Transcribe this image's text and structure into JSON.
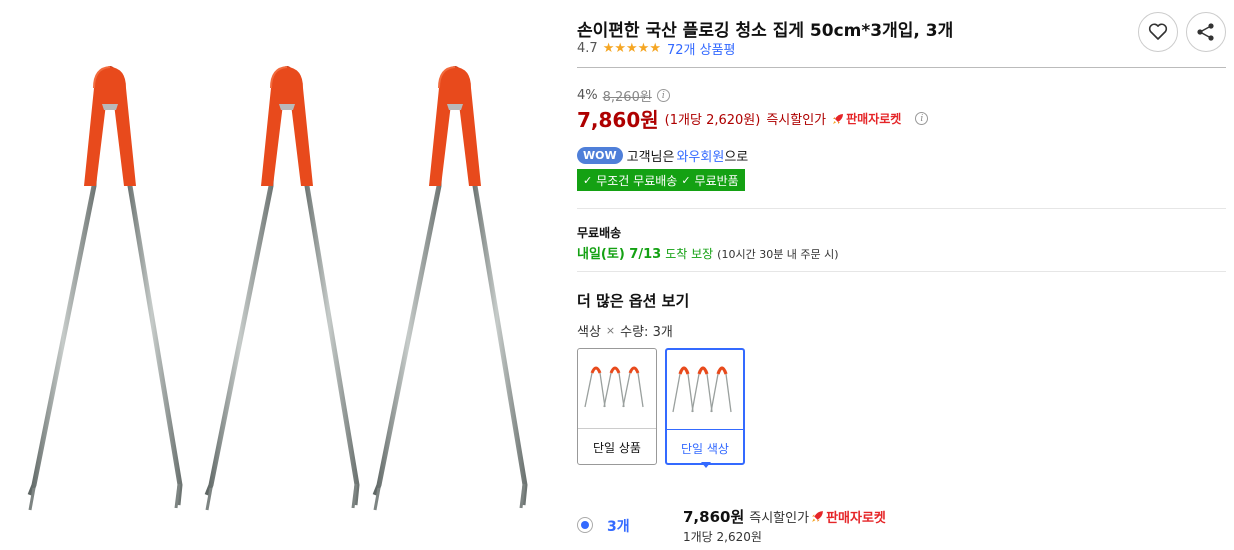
{
  "product": {
    "title": "손이편한 국산 플로깅 청소 집게 50cm*3개입, 3개",
    "rating": "4.7",
    "rating_stars": 5,
    "review_count": "72개 상품평"
  },
  "pricing": {
    "discount_rate": "4%",
    "original_price": "8,260원",
    "sale_price": "7,860원",
    "unit_price": "(1개당 2,620원)",
    "instant_discount": "즉시할인가",
    "rocket_badge": "판매자로켓"
  },
  "membership": {
    "wow_badge": "WOW",
    "text_before": "고객님은",
    "wow_link": "와우회원",
    "text_after": "으로",
    "benefit_1": "무조건 무료배송",
    "benefit_2": "무료반품"
  },
  "shipping": {
    "label": "무료배송",
    "date": "내일(토) 7/13",
    "guarantee": "도착 보장",
    "note": "(10시간 30분 내 주문 시)"
  },
  "options": {
    "heading": "더 많은 옵션 보기",
    "sub_color": "색상",
    "sub_times": "×",
    "sub_qty": "수량: 3개",
    "cards": [
      {
        "label": "단일 상품",
        "selected": false
      },
      {
        "label": "단일 색상",
        "selected": true
      }
    ]
  },
  "quantity_row": {
    "qty": "3개",
    "price": "7,860원",
    "discount": "즉시할인가",
    "rocket": "판매자로켓",
    "unit": "1개당 2,620원"
  },
  "colors": {
    "accent_blue": "#346aff",
    "price_red": "#ae0000",
    "rocket_red": "#e52528",
    "benefit_green": "#14a113",
    "tong_handle": "#e84a1c"
  },
  "icons": [
    "heart-icon",
    "share-icon",
    "star-icon",
    "info-icon",
    "rocket-icon",
    "check-icon"
  ]
}
